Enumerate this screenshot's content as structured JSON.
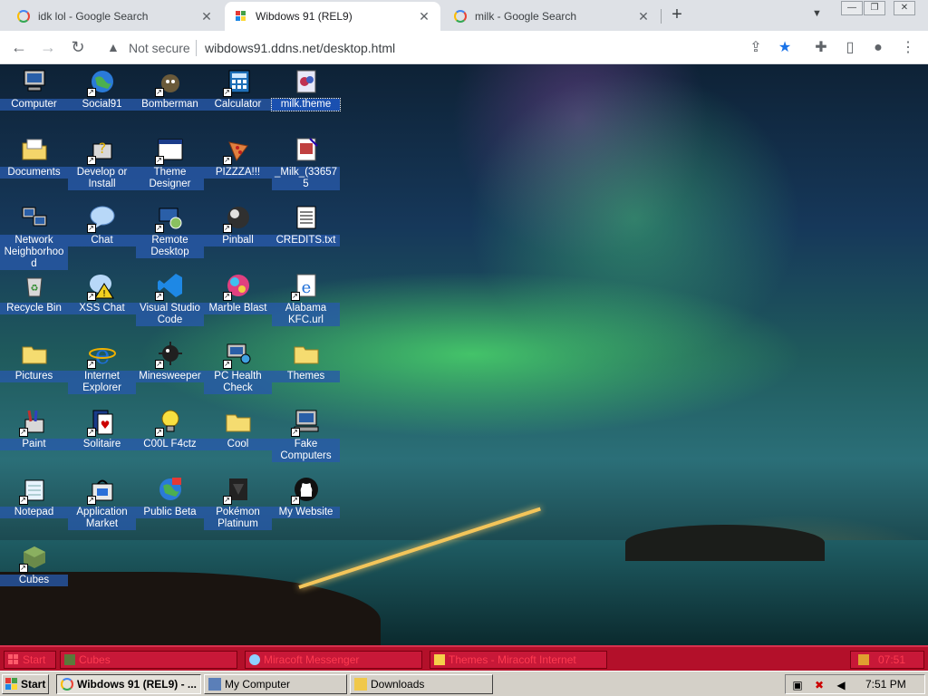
{
  "tabs": [
    {
      "title": "idk lol - Google Search",
      "active": false,
      "icon": "google-g-icon"
    },
    {
      "title": "Wibdows 91 (REL9)",
      "active": true,
      "icon": "wibdows-flag-icon"
    },
    {
      "title": "milk - Google Search",
      "active": false,
      "icon": "google-g-icon"
    }
  ],
  "address_bar": {
    "security": "Not secure",
    "url": "wibdows91.ddns.net/desktop.html"
  },
  "desktop_icons": [
    {
      "label": "Computer",
      "icon": "computer-icon",
      "shortcut": false
    },
    {
      "label": "Social91",
      "icon": "globe-icon",
      "shortcut": true
    },
    {
      "label": "Bomberman",
      "icon": "bomber-icon",
      "shortcut": true
    },
    {
      "label": "Calculator",
      "icon": "calculator-icon",
      "shortcut": true
    },
    {
      "label": "milk.theme",
      "icon": "theme-file-icon",
      "shortcut": false,
      "selected": true
    },
    {
      "label": "Documents",
      "icon": "documents-folder-icon",
      "shortcut": false
    },
    {
      "label": "Develop or Install",
      "icon": "help-install-icon",
      "shortcut": true
    },
    {
      "label": "Theme Designer",
      "icon": "window-app-icon",
      "shortcut": true
    },
    {
      "label": "PIZZZA!!!",
      "icon": "pizza-icon",
      "shortcut": true
    },
    {
      "label": "_Milk_(336575",
      "icon": "image-file-icon",
      "shortcut": false
    },
    {
      "label": "Network Neighborhood",
      "icon": "network-icon",
      "shortcut": false
    },
    {
      "label": "Chat",
      "icon": "chat-bubble-icon",
      "shortcut": true
    },
    {
      "label": "Remote Desktop",
      "icon": "remote-desktop-icon",
      "shortcut": true
    },
    {
      "label": "Pinball",
      "icon": "pinball-icon",
      "shortcut": true
    },
    {
      "label": "CREDITS.txt",
      "icon": "text-file-icon",
      "shortcut": false
    },
    {
      "label": "Recycle Bin",
      "icon": "recycle-bin-icon",
      "shortcut": false
    },
    {
      "label": "XSS Chat",
      "icon": "warning-chat-icon",
      "shortcut": true
    },
    {
      "label": "Visual Studio Code",
      "icon": "vscode-icon",
      "shortcut": true
    },
    {
      "label": "Marble Blast",
      "icon": "marble-icon",
      "shortcut": true
    },
    {
      "label": "Alabama KFC.url",
      "icon": "ie-url-icon",
      "shortcut": true
    },
    {
      "label": "Pictures",
      "icon": "folder-icon",
      "shortcut": false
    },
    {
      "label": "Internet Explorer",
      "icon": "internet-explorer-icon",
      "shortcut": true
    },
    {
      "label": "Minesweeper",
      "icon": "mine-icon",
      "shortcut": true
    },
    {
      "label": "PC Health Check",
      "icon": "pc-health-icon",
      "shortcut": true
    },
    {
      "label": "Themes",
      "icon": "folder-icon",
      "shortcut": false
    },
    {
      "label": "Paint",
      "icon": "paint-icon",
      "shortcut": true
    },
    {
      "label": "Solitaire",
      "icon": "solitaire-icon",
      "shortcut": true
    },
    {
      "label": "C00L F4ctz",
      "icon": "bulb-icon",
      "shortcut": true
    },
    {
      "label": "Cool",
      "icon": "folder-icon",
      "shortcut": false
    },
    {
      "label": "Fake Computers",
      "icon": "fake-computer-icon",
      "shortcut": true
    },
    {
      "label": "Notepad",
      "icon": "notepad-icon",
      "shortcut": true
    },
    {
      "label": "Application Market",
      "icon": "app-market-icon",
      "shortcut": true
    },
    {
      "label": "Public Beta",
      "icon": "public-beta-icon",
      "shortcut": false
    },
    {
      "label": "Pokémon Platinum",
      "icon": "pokemon-icon",
      "shortcut": true
    },
    {
      "label": "My Website",
      "icon": "github-icon",
      "shortcut": true
    },
    {
      "label": "Cubes",
      "icon": "cube-icon",
      "shortcut": true
    }
  ],
  "win91_taskbar": {
    "start": "Start",
    "windows": [
      {
        "label": "Cubes",
        "icon": "cube-icon"
      },
      {
        "label": "Miracoft Messenger",
        "icon": "messenger-icon"
      },
      {
        "label": "Themes - Miracoft Internet",
        "icon": "folder-icon"
      }
    ],
    "clock": "07:51"
  },
  "os_taskbar": {
    "start": "Start",
    "buttons": [
      {
        "label": "Wibdows 91 (REL9) - ...",
        "pressed": true,
        "icon": "chrome-icon"
      },
      {
        "label": "My Computer",
        "pressed": false,
        "icon": "computer-icon"
      },
      {
        "label": "Downloads",
        "pressed": false,
        "icon": "folder-icon"
      }
    ],
    "clock": "7:51 PM"
  }
}
